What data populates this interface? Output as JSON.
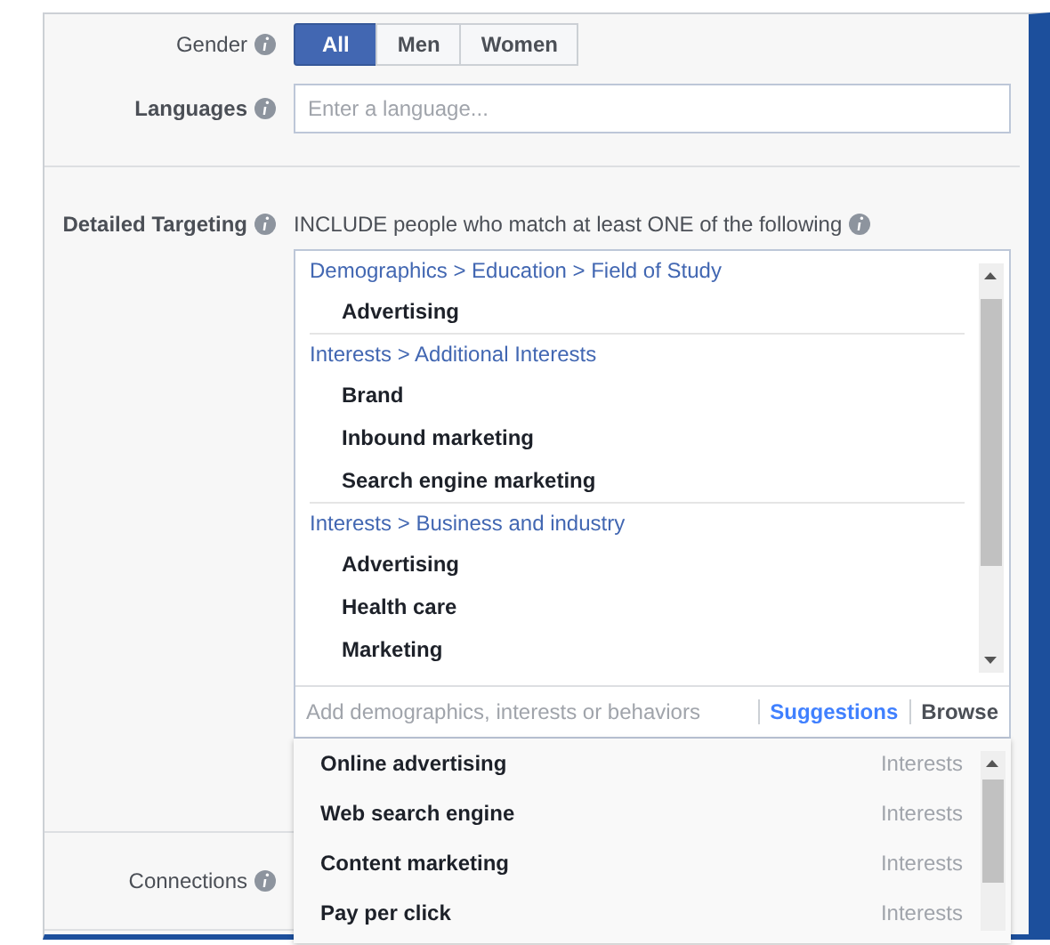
{
  "gender": {
    "label": "Gender",
    "options": [
      {
        "label": "All",
        "selected": true
      },
      {
        "label": "Men",
        "selected": false
      },
      {
        "label": "Women",
        "selected": false
      }
    ]
  },
  "languages": {
    "label": "Languages",
    "placeholder": "Enter a language..."
  },
  "detailed_targeting": {
    "label": "Detailed Targeting",
    "include_text": "INCLUDE people who match at least ONE of the following",
    "groups": [
      {
        "path": "Demographics > Education > Field of Study",
        "items": [
          "Advertising"
        ]
      },
      {
        "path": "Interests > Additional Interests",
        "items": [
          "Brand",
          "Inbound marketing",
          "Search engine marketing"
        ]
      },
      {
        "path": "Interests > Business and industry",
        "items": [
          "Advertising",
          "Health care",
          "Marketing"
        ]
      }
    ],
    "search": {
      "placeholder": "Add demographics, interests or behaviors"
    },
    "links": [
      {
        "label": "Suggestions",
        "selected": true
      },
      {
        "label": "Browse",
        "selected": false
      }
    ],
    "suggestions": [
      {
        "name": "Online advertising",
        "category": "Interests"
      },
      {
        "name": "Web search engine",
        "category": "Interests"
      },
      {
        "name": "Content marketing",
        "category": "Interests"
      },
      {
        "name": "Pay per click",
        "category": "Interests"
      }
    ]
  },
  "connections": {
    "label": "Connections"
  }
}
